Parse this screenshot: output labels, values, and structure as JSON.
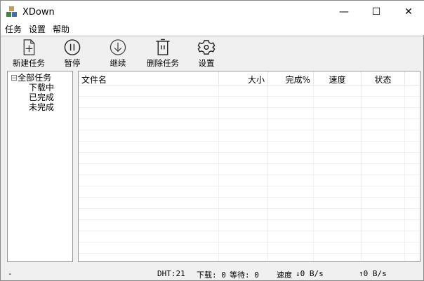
{
  "window": {
    "title": "XDown",
    "minimize": "—",
    "maximize": "☐",
    "close": "✕"
  },
  "menu": [
    "任务",
    "设置",
    "帮助"
  ],
  "toolbar": {
    "new": "新建任务",
    "pause": "暂停",
    "resume": "继续",
    "delete": "删除任务",
    "settings": "设置"
  },
  "tree": {
    "root": "全部任务",
    "children": [
      "下载中",
      "已完成",
      "未完成"
    ],
    "expander": "⊟"
  },
  "columns": [
    "文件名",
    "大小",
    "完成%",
    "速度",
    "状态"
  ],
  "status": {
    "left": "-",
    "dht": "DHT:21",
    "downloading": "下载: 0",
    "waiting": "等待: 0",
    "speed_label": "速度",
    "down_speed": "↓0 B/s",
    "up_speed": "↑0 B/s"
  }
}
